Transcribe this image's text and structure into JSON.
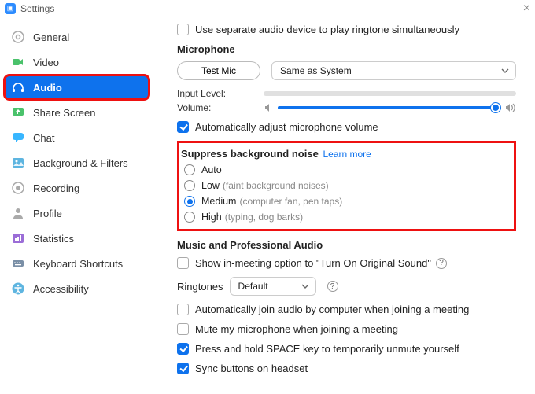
{
  "window": {
    "title": "Settings"
  },
  "sidebar": {
    "items": [
      {
        "label": "General"
      },
      {
        "label": "Video"
      },
      {
        "label": "Audio"
      },
      {
        "label": "Share Screen"
      },
      {
        "label": "Chat"
      },
      {
        "label": "Background & Filters"
      },
      {
        "label": "Recording"
      },
      {
        "label": "Profile"
      },
      {
        "label": "Statistics"
      },
      {
        "label": "Keyboard Shortcuts"
      },
      {
        "label": "Accessibility"
      }
    ]
  },
  "audio": {
    "separate_device": "Use separate audio device to play ringtone simultaneously",
    "mic_heading": "Microphone",
    "test_mic": "Test Mic",
    "mic_device": "Same as System",
    "input_level": "Input Level:",
    "volume": "Volume:",
    "auto_adjust": "Automatically adjust microphone volume",
    "suppress": {
      "title": "Suppress background noise",
      "learn": "Learn more",
      "options": [
        {
          "label": "Auto",
          "hint": ""
        },
        {
          "label": "Low",
          "hint": "(faint background noises)"
        },
        {
          "label": "Medium",
          "hint": "(computer fan, pen taps)"
        },
        {
          "label": "High",
          "hint": "(typing, dog barks)"
        }
      ]
    },
    "music_heading": "Music and Professional Audio",
    "original_sound": "Show in-meeting option to \"Turn On Original Sound\"",
    "ringtones_label": "Ringtones",
    "ringtone_value": "Default",
    "auto_join": "Automatically join audio by computer when joining a meeting",
    "mute_join": "Mute my microphone when joining a meeting",
    "space_unmute": "Press and hold SPACE key to temporarily unmute yourself",
    "sync_headset": "Sync buttons on headset"
  }
}
